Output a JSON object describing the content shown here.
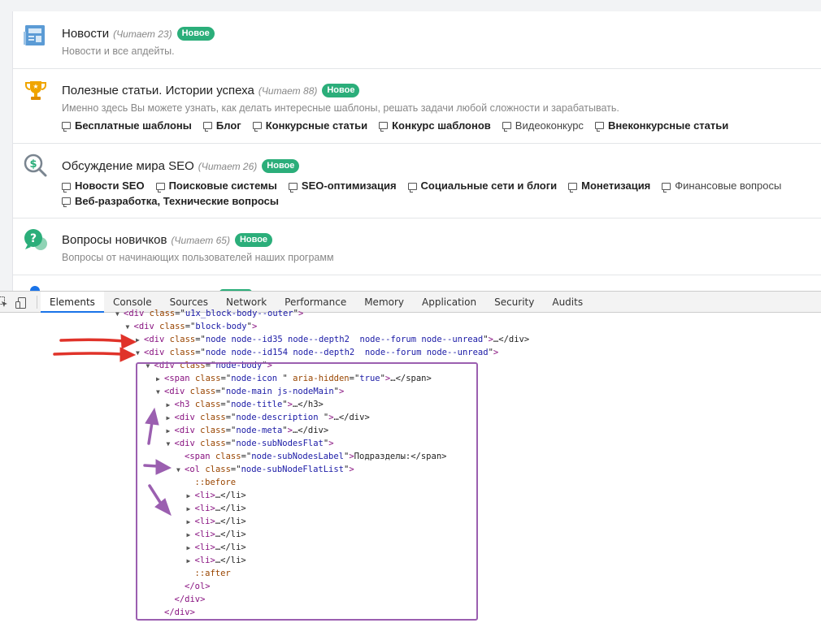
{
  "forums": [
    {
      "icon": "newspaper-icon",
      "title": "Новости",
      "readers": "(Читает 23)",
      "badge": "Новое",
      "description": "Новости и все апдейты.",
      "subforums": []
    },
    {
      "icon": "trophy-icon",
      "title": "Полезные статьи. Истории успеха",
      "readers": "(Читает 88)",
      "badge": "Новое",
      "description": "Именно здесь Вы можете узнать, как делать интересные шаблоны, решать задачи любой сложности и зарабатывать.",
      "subforums": [
        {
          "label": "Бесплатные шаблоны",
          "bold": true
        },
        {
          "label": "Блог",
          "bold": true
        },
        {
          "label": "Конкурсные статьи",
          "bold": true
        },
        {
          "label": "Конкурс шаблонов",
          "bold": true
        },
        {
          "label": "Видеоконкурс",
          "bold": false
        },
        {
          "label": "Внеконкурсные статьи",
          "bold": true
        }
      ]
    },
    {
      "icon": "seo-search-dollar-icon",
      "title": "Обсуждение мира SEO",
      "readers": "(Читает 26)",
      "badge": "Новое",
      "description": "",
      "subforums": [
        {
          "label": "Новости SEO",
          "bold": true
        },
        {
          "label": "Поисковые системы",
          "bold": true
        },
        {
          "label": "SEO-оптимизация",
          "bold": true
        },
        {
          "label": "Социальные сети и блоги",
          "bold": true
        },
        {
          "label": "Монетизация",
          "bold": true
        },
        {
          "label": "Финансовые вопросы",
          "bold": false
        },
        {
          "label": "Веб-разработка, Технические вопросы",
          "bold": true
        }
      ]
    },
    {
      "icon": "question-chat-icon",
      "title": "Вопросы новичков",
      "readers": "(Читает 65)",
      "badge": "Новое",
      "description": "Вопросы от начинающих пользователей наших программ",
      "subforums": []
    }
  ],
  "devtools": {
    "tabs": [
      "Elements",
      "Console",
      "Sources",
      "Network",
      "Performance",
      "Memory",
      "Application",
      "Security",
      "Audits"
    ],
    "active_tab": "Elements",
    "tree": [
      {
        "indent": 0,
        "arrow": "open",
        "tag": "div",
        "attrs": [
          [
            "class",
            "u1x_block-body--outer"
          ]
        ],
        "tail": ""
      },
      {
        "indent": 1,
        "arrow": "open",
        "tag": "div",
        "attrs": [
          [
            "class",
            "block-body"
          ]
        ],
        "tail": ""
      },
      {
        "indent": 2,
        "arrow": "closed",
        "tag": "div",
        "attrs": [
          [
            "class",
            "node node--id35 node--depth2  node--forum node--unread"
          ]
        ],
        "tail": "…</div>"
      },
      {
        "indent": 2,
        "arrow": "open",
        "tag": "div",
        "attrs": [
          [
            "class",
            "node node--id154 node--depth2  node--forum node--unread"
          ]
        ],
        "tail": ""
      },
      {
        "indent": 3,
        "arrow": "open",
        "tag": "div",
        "attrs": [
          [
            "class",
            "node-body"
          ]
        ],
        "tail": ""
      },
      {
        "indent": 4,
        "arrow": "closed",
        "tag": "span",
        "attrs": [
          [
            "class",
            "node-icon "
          ],
          [
            "aria-hidden",
            "true"
          ]
        ],
        "tail": "…</span>"
      },
      {
        "indent": 4,
        "arrow": "open",
        "tag": "div",
        "attrs": [
          [
            "class",
            "node-main js-nodeMain"
          ]
        ],
        "tail": ""
      },
      {
        "indent": 5,
        "arrow": "closed",
        "tag": "h3",
        "attrs": [
          [
            "class",
            "node-title"
          ]
        ],
        "tail": "…</h3>"
      },
      {
        "indent": 5,
        "arrow": "closed",
        "tag": "div",
        "attrs": [
          [
            "class",
            "node-description "
          ]
        ],
        "tail": "…</div>"
      },
      {
        "indent": 5,
        "arrow": "closed",
        "tag": "div",
        "attrs": [
          [
            "class",
            "node-meta"
          ]
        ],
        "tail": "…</div>"
      },
      {
        "indent": 5,
        "arrow": "open",
        "tag": "div",
        "attrs": [
          [
            "class",
            "node-subNodesFlat"
          ]
        ],
        "tail": ""
      },
      {
        "indent": 6,
        "arrow": "none",
        "tag": "span",
        "attrs": [
          [
            "class",
            "node-subNodesLabel"
          ]
        ],
        "tail": "Подразделы:</span>"
      },
      {
        "indent": 6,
        "arrow": "open",
        "tag": "ol",
        "attrs": [
          [
            "class",
            "node-subNodeFlatList"
          ]
        ],
        "tail": ""
      },
      {
        "indent": 7,
        "pseudo": "::before"
      },
      {
        "indent": 7,
        "arrow": "closed",
        "tag": "li",
        "attrs": [],
        "tail": "…</li>"
      },
      {
        "indent": 7,
        "arrow": "closed",
        "tag": "li",
        "attrs": [],
        "tail": "…</li>"
      },
      {
        "indent": 7,
        "arrow": "closed",
        "tag": "li",
        "attrs": [],
        "tail": "…</li>"
      },
      {
        "indent": 7,
        "arrow": "closed",
        "tag": "li",
        "attrs": [],
        "tail": "…</li>"
      },
      {
        "indent": 7,
        "arrow": "closed",
        "tag": "li",
        "attrs": [],
        "tail": "…</li>"
      },
      {
        "indent": 7,
        "arrow": "closed",
        "tag": "li",
        "attrs": [],
        "tail": "…</li>"
      },
      {
        "indent": 7,
        "pseudo": "::after"
      },
      {
        "indent": 6,
        "close": "</ol>"
      },
      {
        "indent": 5,
        "close": "</div>"
      },
      {
        "indent": 4,
        "close": "</div>"
      }
    ]
  },
  "colors": {
    "badge": "#2bae7a",
    "annotation_red": "#e0332a",
    "annotation_purple": "#9b5fb0",
    "tag": "#881280",
    "attr_name": "#994500",
    "attr_value": "#1a1aa6"
  }
}
